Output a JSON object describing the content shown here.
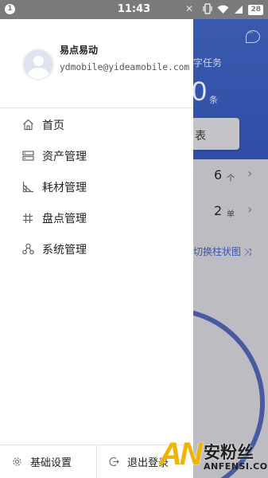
{
  "status_bar": {
    "notification_badge": "1",
    "time": "11:43",
    "battery": "28"
  },
  "drawer": {
    "user": {
      "name": "易点易动",
      "email": "ydmobile@yideamobile.com"
    },
    "menu": [
      {
        "label": "首页",
        "icon": "home-icon"
      },
      {
        "label": "资产管理",
        "icon": "asset-icon"
      },
      {
        "label": "耗材管理",
        "icon": "consumable-icon"
      },
      {
        "label": "盘点管理",
        "icon": "inventory-icon"
      },
      {
        "label": "系统管理",
        "icon": "system-icon"
      }
    ],
    "footer": {
      "settings_label": "基础设置",
      "logout_label": "退出登录"
    }
  },
  "background": {
    "task_text": "字任务",
    "count": "0",
    "count_unit": "条",
    "card_label": "表",
    "rows": [
      {
        "value": "6",
        "unit": "个"
      },
      {
        "value": "2",
        "unit": "单"
      }
    ],
    "switch_label": "切换柱状图"
  },
  "watermark": {
    "logo": "AN",
    "cn": "安粉丝",
    "en": "ANFENSI.COM"
  },
  "colors": {
    "status_bar": "#7a7a7a",
    "banner": "#2f4fa6",
    "accent": "#3b55a8",
    "watermark": "#f0b400"
  }
}
